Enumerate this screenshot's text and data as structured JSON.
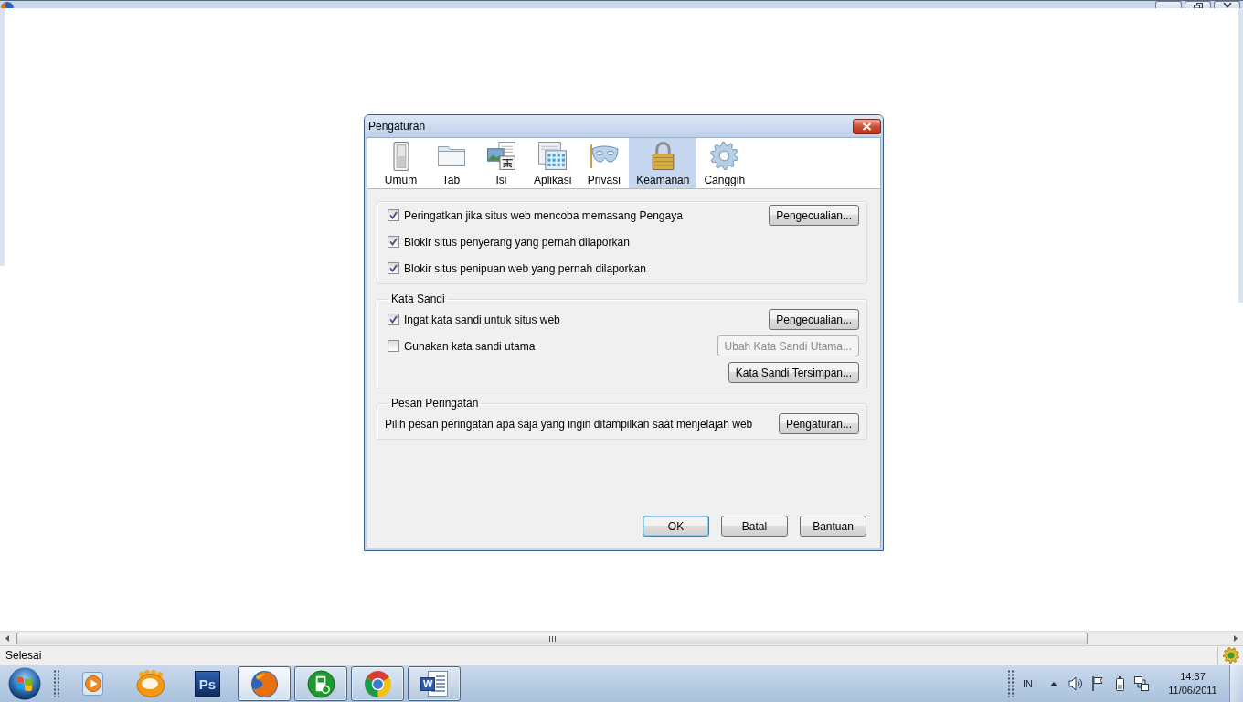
{
  "dialog": {
    "title": "Pengaturan",
    "tabs": [
      {
        "label": "Umum",
        "kind": "switch",
        "selected": false
      },
      {
        "label": "Tab",
        "kind": "folder",
        "selected": false
      },
      {
        "label": "Isi",
        "kind": "content",
        "selected": false
      },
      {
        "label": "Aplikasi",
        "kind": "apps",
        "selected": false
      },
      {
        "label": "Privasi",
        "kind": "mask",
        "selected": false
      },
      {
        "label": "Keamanan",
        "kind": "lock",
        "selected": true
      },
      {
        "label": "Canggih",
        "kind": "gear",
        "selected": false
      }
    ],
    "groups": [
      {
        "rows": [
          {
            "kind": "checkbox",
            "label": "Peringatkan jika situs web mencoba memasang Pengaya",
            "checked": true,
            "button": {
              "label": "Pengecualian...",
              "disabled": false
            }
          },
          {
            "kind": "checkbox",
            "label": "Blokir situs penyerang yang pernah dilaporkan",
            "checked": true
          },
          {
            "kind": "checkbox",
            "label": "Blokir situs penipuan web yang pernah dilaporkan",
            "checked": true
          }
        ]
      },
      {
        "caption": "Kata Sandi",
        "rows": [
          {
            "kind": "checkbox",
            "label": "Ingat kata sandi untuk situs web",
            "checked": true,
            "button": {
              "label": "Pengecualian...",
              "disabled": false
            }
          },
          {
            "kind": "checkbox",
            "label": "Gunakan kata sandi utama",
            "checked": false,
            "button": {
              "label": "Ubah Kata Sandi Utama...",
              "disabled": true
            }
          },
          {
            "kind": "button",
            "button": {
              "label": "Kata Sandi Tersimpan...",
              "disabled": false
            }
          }
        ]
      },
      {
        "caption": "Pesan Peringatan",
        "rows": [
          {
            "kind": "text",
            "text": "Pilih pesan peringatan apa saja yang ingin ditampilkan saat menjelajah web",
            "button": {
              "label": "Pengaturan...",
              "disabled": false
            }
          }
        ]
      }
    ],
    "buttons": [
      {
        "label": "OK",
        "default": true
      },
      {
        "label": "Batal",
        "default": false
      },
      {
        "label": "Bantuan",
        "default": false
      }
    ]
  },
  "status_bar": {
    "text": "Selesai"
  },
  "taskbar": {
    "apps": [
      {
        "kind": "player",
        "running": false,
        "active": false
      },
      {
        "kind": "blob",
        "running": false,
        "active": false
      },
      {
        "kind": "tile",
        "label": "Ps",
        "running": false,
        "active": false
      },
      {
        "kind": "fox",
        "running": true,
        "active": true
      },
      {
        "kind": "device",
        "running": true,
        "active": false
      },
      {
        "kind": "ring",
        "running": true,
        "active": false
      },
      {
        "kind": "document",
        "label": "W",
        "running": true,
        "active": false
      }
    ],
    "tray": {
      "language": "IN",
      "time": "14:37",
      "date": "11/06/2011"
    }
  }
}
